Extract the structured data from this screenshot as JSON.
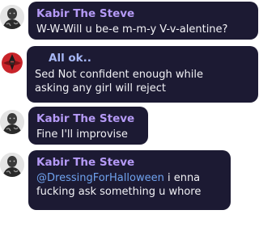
{
  "messages": [
    {
      "sender": "Kabir The Steve",
      "avatar_icon": "tattooed-man-avatar-icon",
      "text": "W-W-Will u be-e m-m-y V-v-alentine?"
    },
    {
      "sender": "All ok..",
      "avatar_icon": "red-reaper-avatar-icon",
      "text_lines": [
        "Sed Not confident enough while",
        "asking any girl will reject"
      ]
    },
    {
      "sender": "Kabir The Steve",
      "avatar_icon": "tattooed-man-avatar-icon",
      "text": "Fine I'll improvise"
    },
    {
      "sender": "Kabir The Steve",
      "avatar_icon": "tattooed-man-avatar-icon",
      "mention": "@DressingForHalloween",
      "text_after_mention": " i enna",
      "text_line2": "fucking ask something u whore"
    }
  ],
  "colors": {
    "bubble": "#1c1a33",
    "sender_name": "#b59af6",
    "message_text": "#f1f1f5",
    "mention": "#6fa2ee",
    "background": "#ffffff"
  }
}
